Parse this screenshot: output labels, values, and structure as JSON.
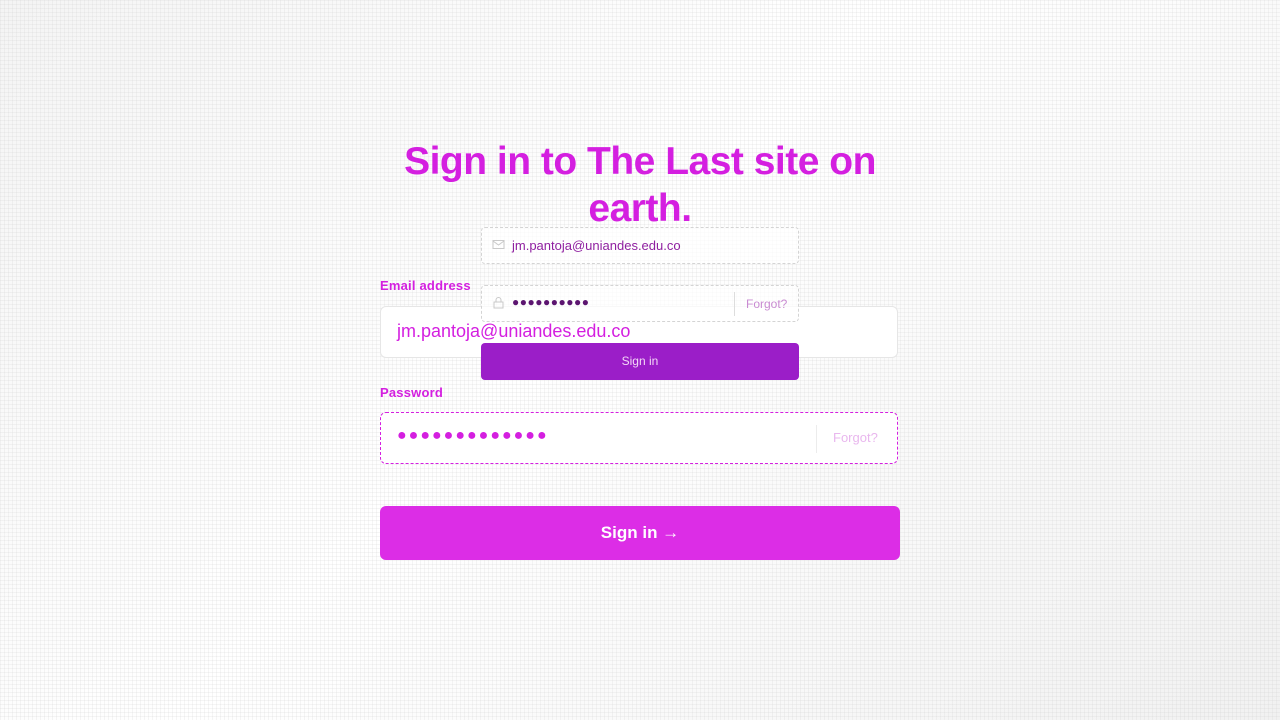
{
  "heading": "Sign in to The Last site on earth.",
  "form": {
    "email_label": "Email address",
    "email_value": "jm.pantoja@uniandes.edu.co",
    "password_label": "Password",
    "password_value": "●●●●●●●●●●●●●",
    "forgot_label": "Forgot?",
    "submit_label": "Sign in →"
  },
  "overlay_form": {
    "email_value": "jm.pantoja@uniandes.edu.co",
    "password_value": "●●●●●●●●●●",
    "forgot_label": "Forgot?",
    "submit_label": "Sign in"
  },
  "colors": {
    "accent": "#d41fe0",
    "overlay_button": "#9b1ec8",
    "border": "#e6e6e6"
  },
  "icons": {
    "overlay_email": "mail-icon",
    "overlay_password": "lock-icon"
  }
}
